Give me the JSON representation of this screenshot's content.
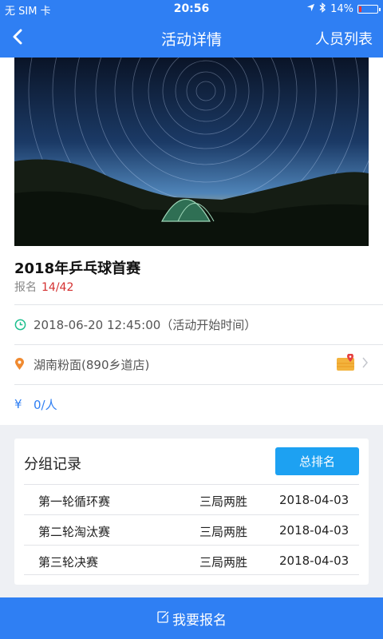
{
  "status": {
    "carrier": "无 SIM 卡",
    "time": "20:56",
    "battery": "14%"
  },
  "nav": {
    "title": "活动详情",
    "right": "人员列表",
    "back_icon": "chevron-left-icon"
  },
  "event": {
    "title": "2018年乒乓球首赛",
    "signup_label": "报名",
    "signup_count": "14/42",
    "datetime": "2018-06-20 12:45:00（活动开始时间）",
    "location": "湖南粉面(890乡道店)",
    "price_symbol": "¥",
    "price": "0/人"
  },
  "groups": {
    "title": "分组记录",
    "rank_button": "总排名",
    "rows": [
      {
        "name": "第一轮循环赛",
        "format": "三局两胜",
        "date": "2018-04-03"
      },
      {
        "name": "第二轮淘汰赛",
        "format": "三局两胜",
        "date": "2018-04-03"
      },
      {
        "name": "第三轮决赛",
        "format": "三局两胜",
        "date": "2018-04-03"
      }
    ]
  },
  "bottom": {
    "signup_button": "我要报名"
  },
  "colors": {
    "primary": "#2f7ff3",
    "accent": "#1da1f2",
    "count_red": "#d43030"
  }
}
